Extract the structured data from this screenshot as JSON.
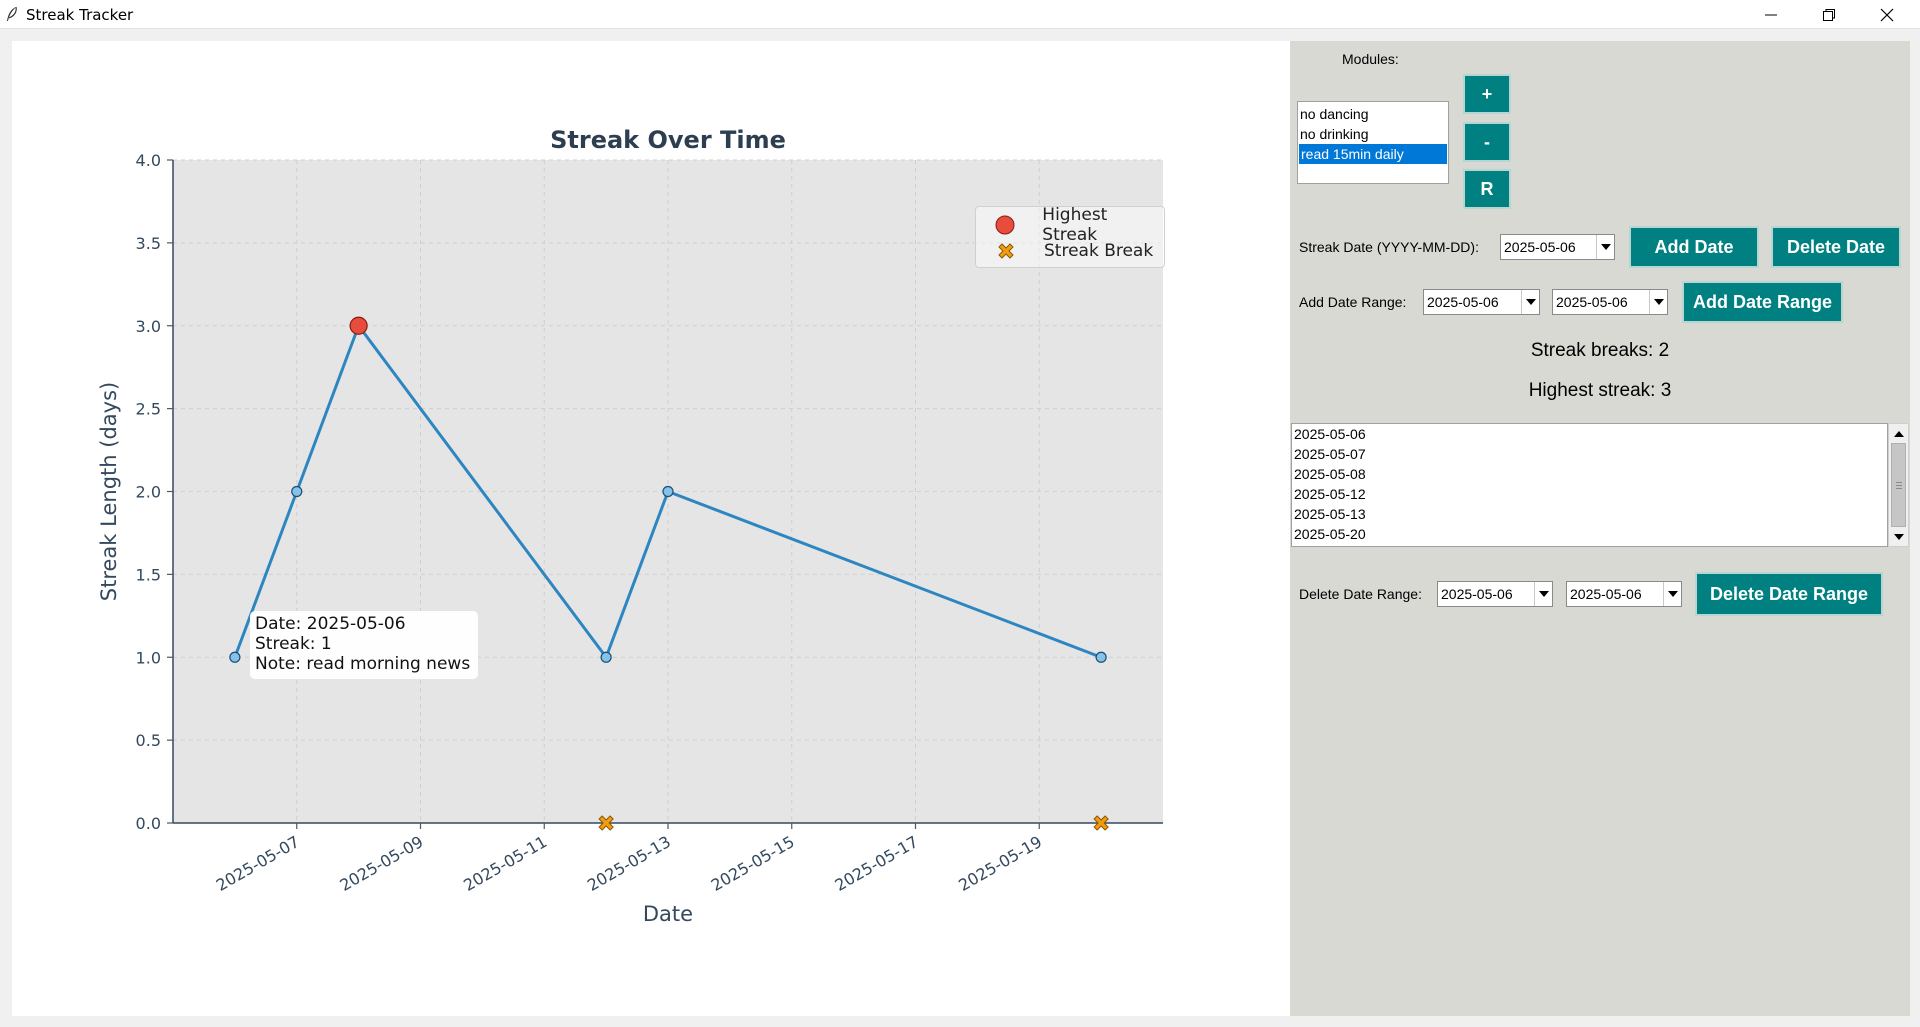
{
  "window": {
    "title": "Streak Tracker",
    "icon": "feather-icon"
  },
  "modules": {
    "label": "Modules:",
    "items": [
      "no dancing",
      "no drinking",
      "read 15min daily"
    ],
    "selected_index": 2,
    "add_label": "+",
    "remove_label": "-",
    "rename_label": "R"
  },
  "streak_date": {
    "label": "Streak Date (YYYY-MM-DD):",
    "value": "2025-05-06",
    "add_button": "Add Date",
    "delete_button": "Delete Date"
  },
  "add_range": {
    "label": "Add Date Range:",
    "start": "2025-05-06",
    "end": "2025-05-06",
    "button": "Add Date Range"
  },
  "stats": {
    "breaks": "Streak breaks: 2",
    "highest": "Highest streak: 3"
  },
  "dates_list": [
    "2025-05-06",
    "2025-05-07",
    "2025-05-08",
    "2025-05-12",
    "2025-05-13",
    "2025-05-20"
  ],
  "delete_range": {
    "label": "Delete Date Range:",
    "start": "2025-05-06",
    "end": "2025-05-06",
    "button": "Delete Date Range"
  },
  "tooltip": {
    "line1": "Date: 2025-05-06",
    "line2": "Streak: 1",
    "line3": "Note: read morning news"
  },
  "chart_data": {
    "type": "line",
    "title": "Streak Over Time",
    "xlabel": "Date",
    "ylabel": "Streak Length (days)",
    "ylim": [
      0,
      4.0
    ],
    "xlim": [
      "2025-05-05",
      "2025-05-21"
    ],
    "yticks": [
      "0.0",
      "0.5",
      "1.0",
      "1.5",
      "2.0",
      "2.5",
      "3.0",
      "3.5",
      "4.0"
    ],
    "xticks": [
      "2025-05-07",
      "2025-05-09",
      "2025-05-11",
      "2025-05-13",
      "2025-05-15",
      "2025-05-17",
      "2025-05-19"
    ],
    "grid": true,
    "legend_position": "top-right",
    "line_color": "#2e86c1",
    "series": [
      {
        "dates": [
          "2025-05-06",
          "2025-05-07",
          "2025-05-08",
          "2025-05-12",
          "2025-05-13",
          "2025-05-20"
        ],
        "values": [
          1,
          2,
          3,
          1,
          2,
          1
        ]
      }
    ],
    "highest_streak": {
      "name": "Highest Streak",
      "date": "2025-05-08",
      "value": 3,
      "color": "#e74c3c"
    },
    "streak_breaks": {
      "name": "Streak Break",
      "dates": [
        "2025-05-12",
        "2025-05-20"
      ],
      "value": 0,
      "color": "#f39c12"
    }
  }
}
